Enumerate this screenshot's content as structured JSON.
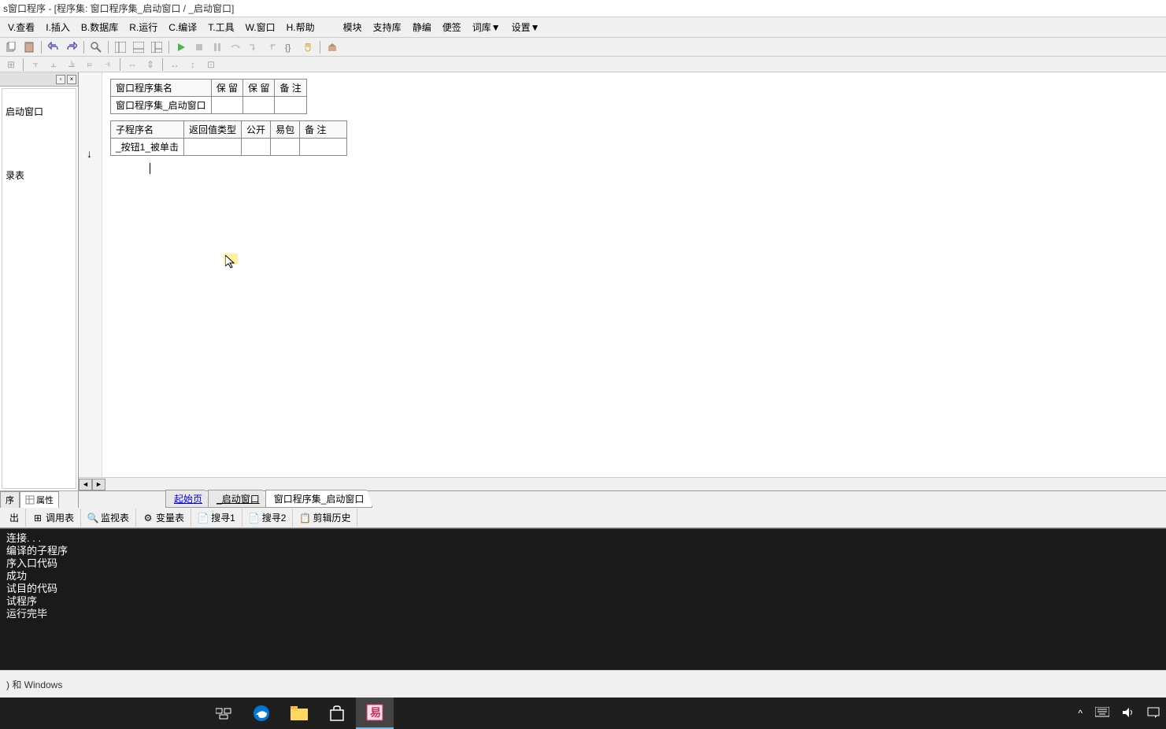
{
  "titlebar": "s窗口程序 - [程序集: 窗口程序集_启动窗口 / _启动窗口]",
  "menu": {
    "view": "V.查看",
    "insert": "I.插入",
    "database": "B.数据库",
    "run": "R.运行",
    "compile": "C.编译",
    "tools": "T.工具",
    "window": "W.窗口",
    "help": "H.帮助",
    "module": "模块",
    "support": "支持库",
    "static": "静编",
    "note": "便签",
    "dict": "词库▼",
    "settings": "设置▼"
  },
  "left_panel": {
    "item1": "启动窗口",
    "item2": "录表",
    "tab_prog": "序",
    "tab_attr": "属性"
  },
  "table1": {
    "h1": "窗口程序集名",
    "h2": "保 留",
    "h3": "保 留",
    "h4": "备 注",
    "r1c1": "窗口程序集_启动窗口"
  },
  "table2": {
    "h1": "子程序名",
    "h2": "返回值类型",
    "h3": "公开",
    "h4": "易包",
    "h5": "备 注",
    "r1c1": "_按钮1_被单击"
  },
  "editor_tabs": {
    "start": "起始页",
    "window": "_启动窗口",
    "assembly": "窗口程序集_启动窗口"
  },
  "bottom_tabs": {
    "output": "出",
    "calltable": "调用表",
    "watch": "监视表",
    "vars": "变量表",
    "search1": "搜寻1",
    "search2": "搜寻2",
    "cliphistory": "剪辑历史"
  },
  "console": {
    "l1": "连接. . .",
    "l2": "编译的子程序",
    "l3": "序入口代码",
    "l4": "成功",
    "l5": "试目的代码",
    "l6": "试程序",
    "l7": "运行完毕"
  },
  "statusbar": ") 和 Windows"
}
